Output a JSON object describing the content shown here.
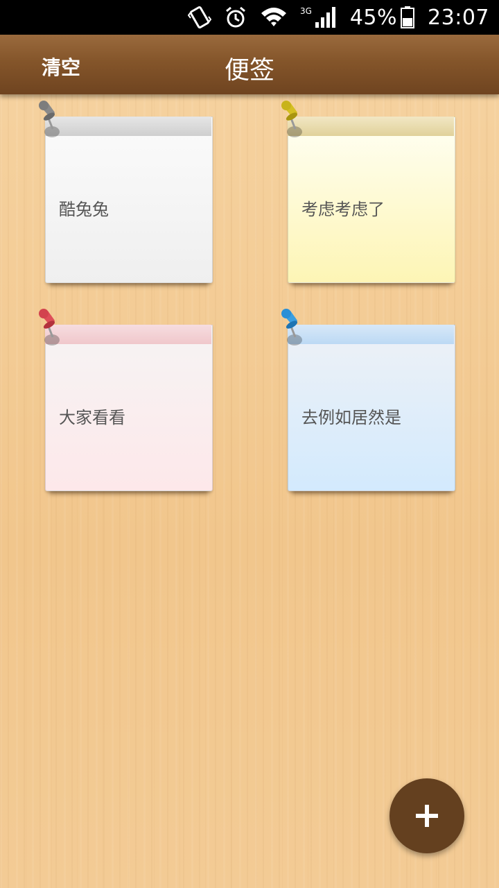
{
  "status_bar": {
    "battery_percent": "45%",
    "time": "23:07",
    "network": "3G",
    "icons": [
      "vibrate-icon",
      "alarm-icon",
      "wifi-icon",
      "signal-icon",
      "battery-icon"
    ]
  },
  "app_bar": {
    "clear_label": "清空",
    "title": "便签"
  },
  "notes": [
    {
      "text": "酷兔兔",
      "color": "gray",
      "pin_color": "#7d7d7d"
    },
    {
      "text": "考虑考虑了",
      "color": "yellow",
      "pin_color": "#c8b31a"
    },
    {
      "text": "大家看看",
      "color": "pink",
      "pin_color": "#d2434e"
    },
    {
      "text": "去例如居然是",
      "color": "blue",
      "pin_color": "#2a8fd6"
    }
  ],
  "fab": {
    "icon": "plus-icon",
    "color": "#64401f"
  }
}
